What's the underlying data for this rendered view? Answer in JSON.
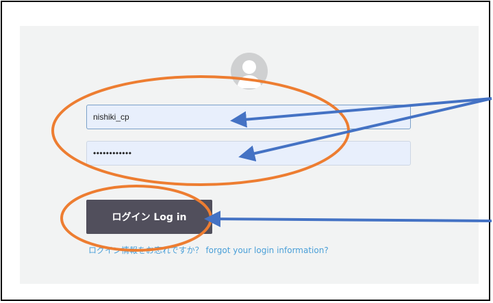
{
  "login_form": {
    "username_value": "nishiki_cp",
    "password_value": "••••••••••••",
    "login_button_label": "ログイン Log in",
    "forgot_link_label": "ログイン情報をお忘れですか？ forgot your login information?"
  },
  "colors": {
    "page_background": "#ffffff",
    "panel_background": "#f2f3f3",
    "input_background": "#e8effc",
    "button_background": "#514f5c",
    "link_color": "#4a9fd8",
    "annotation_circle": "#ed7d31",
    "annotation_arrow": "#4472c4"
  },
  "icons": {
    "avatar": "user-silhouette-icon"
  }
}
